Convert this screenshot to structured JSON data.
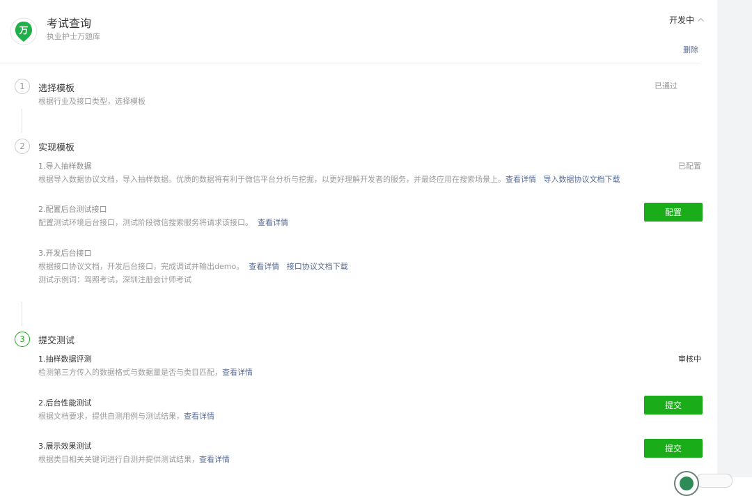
{
  "app": {
    "name": "考试查询",
    "description": "执业护士万题库",
    "logo_char": "万",
    "status": "开发中",
    "delete_label": "删除"
  },
  "steps": [
    {
      "number": "1",
      "title": "选择模板",
      "desc": "根据行业及接口类型，选择模板",
      "status": "已通过"
    },
    {
      "number": "2",
      "title": "实现模板",
      "substeps": [
        {
          "title": "1.导入抽样数据",
          "desc": "根据导入数据协议文档，导入抽样数据。优质的数据将有利于微信平台分析与挖掘，以更好理解开发者的服务，并最终应用在搜索场景上。",
          "link1": "查看详情",
          "link2": "导入数据协议文档下载",
          "status": "已配置"
        },
        {
          "title": "2.配置后台测试接口",
          "desc": "配置测试环境后台接口，测试阶段微信搜索服务将请求该接口。",
          "link1": "查看详情",
          "button": "配置"
        },
        {
          "title": "3.开发后台接口",
          "desc": "根据接口协议文档，开发后台接口，完成调试并输出demo。",
          "link1": "查看详情",
          "link2": "接口协议文档下载",
          "example": "测试示例词：驾照考试，深圳注册会计师考试"
        }
      ]
    },
    {
      "number": "3",
      "title": "提交测试",
      "substeps": [
        {
          "title": "1.抽样数据评测",
          "desc": "检测第三方传入的数据格式与数据量是否与类目匹配，",
          "link1": "查看详情",
          "status": "审核中"
        },
        {
          "title": "2.后台性能测试",
          "desc": "根据文档要求，提供自测用例与测试结果，",
          "link1": "查看详情",
          "button": "提交"
        },
        {
          "title": "3.展示效果测试",
          "desc": "根据类目相关关键词进行自测并提供测试结果，",
          "link1": "查看详情",
          "button": "提交"
        }
      ]
    }
  ],
  "colors": {
    "accent_green": "#1aad19",
    "link_blue": "#576b95"
  }
}
